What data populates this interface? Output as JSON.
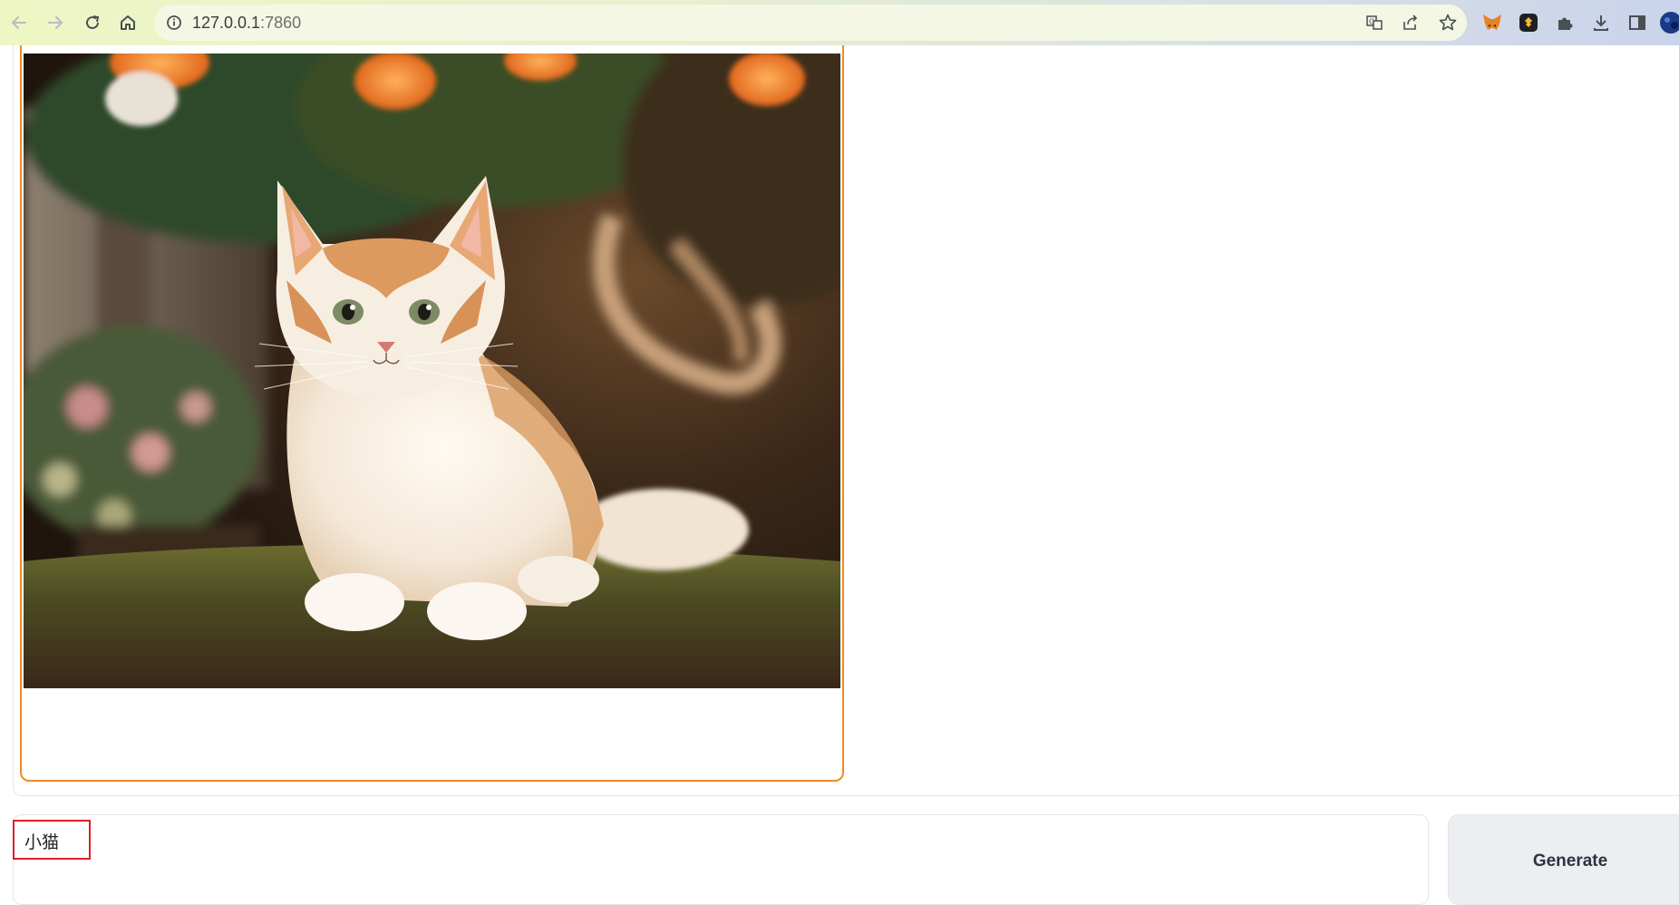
{
  "browser": {
    "url_host": "127.0.0.1",
    "url_port": ":7860",
    "icons": [
      "back-icon",
      "forward-icon",
      "reload-icon",
      "home-icon",
      "info-icon",
      "translate-icon",
      "share-icon",
      "star-icon",
      "metamask-icon",
      "binance-icon",
      "extensions-icon",
      "download-icon",
      "sidepanel-icon",
      "profile-icon"
    ]
  },
  "image": {
    "description_alt": "kitten"
  },
  "prompt": {
    "value": "小猫"
  },
  "generate": {
    "label": "Generate"
  },
  "colors": {
    "accent": "#f08a24",
    "highlight": "#e0202a",
    "button_bg": "#eceef2"
  }
}
